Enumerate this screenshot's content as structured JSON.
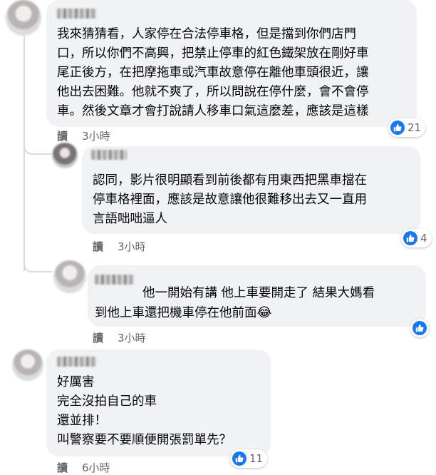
{
  "comments": [
    {
      "text": "我來猜猜看，人家停在合法停車格，但是擋到你們店門\n口，所以你們不高興，把禁止停車的紅色鐵架放在剛好車\n尾正後方，在把摩拖車或汽車故意停在離他車頭很近，讓\n他出去困難。他就不爽了，所以問說在停什麼，會不會停\n車。然後文章才會打說請人移車口氣這麼差，應該是這樣",
      "reactions": "21",
      "read_label": "讀",
      "time": "3小時"
    },
    {
      "text": "認同，影片很明顯看到前後都有用東西把黑車擋在\n停車格裡面，應該是故意讓他很難移出去又一直用\n言語咄咄逼人",
      "reactions": "4",
      "read_label": "讀",
      "time": "3小時"
    },
    {
      "text": "他一開始有講 他上車要開走了 結果大媽看\n到他上車還把機車停在他前面",
      "emoji": "😂",
      "read_label": "讀",
      "time": "3小時"
    },
    {
      "text": "好厲害\n完全沒拍自己的車\n還並排！\n叫警察要不要順便開張罰單先？",
      "reactions": "11",
      "read_label": "讀",
      "time": "6小時"
    }
  ],
  "colors": {
    "like_blue": "#1877f2",
    "bubble_bg": "#f0f2f5",
    "meta_gray": "#65676b"
  },
  "icons": {
    "like": "thumbs-up-icon",
    "emoji": "laughing-tears-emoji"
  }
}
